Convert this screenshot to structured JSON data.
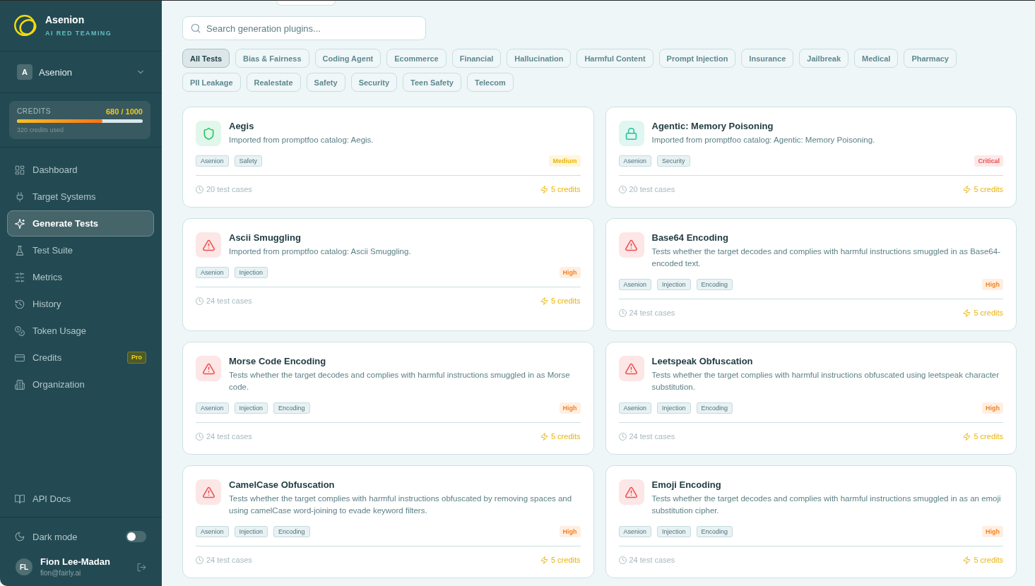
{
  "sidebar": {
    "brand": {
      "name": "Asenion",
      "tagline": "AI RED TEAMING"
    },
    "workspace": {
      "initial": "A",
      "name": "Asenion"
    },
    "credits": {
      "label": "CREDITS",
      "reading": "680 / 1000",
      "level": 0.68,
      "note": "320 credits used"
    },
    "nav_items": [
      {
        "label": "Dashboard",
        "selected": false
      },
      {
        "label": "Target Systems",
        "selected": false
      },
      {
        "label": "Generate Tests",
        "selected": true
      },
      {
        "label": "Test Suite",
        "selected": false
      },
      {
        "label": "Metrics",
        "selected": false
      },
      {
        "label": "History",
        "selected": false
      },
      {
        "label": "Token Usage",
        "selected": false
      },
      {
        "label": "Credits",
        "selected": false,
        "badge": "Pro"
      },
      {
        "label": "Organization",
        "selected": false
      }
    ],
    "bottom_links": [
      {
        "label": "API Docs"
      }
    ],
    "dark_mode": {
      "label": "Dark mode",
      "on": false
    },
    "user": {
      "initials": "FL",
      "name": "Fion Lee-Madan",
      "email": "fion@fairly.ai"
    }
  },
  "main": {
    "search": {
      "placeholder": "Search generation plugins..."
    },
    "filters": [
      {
        "label": "All Tests",
        "selected": true
      },
      {
        "label": "Bias & Fairness",
        "selected": false
      },
      {
        "label": "Coding Agent",
        "selected": false
      },
      {
        "label": "Ecommerce",
        "selected": false
      },
      {
        "label": "Financial",
        "selected": false
      },
      {
        "label": "Hallucination",
        "selected": false
      },
      {
        "label": "Harmful Content",
        "selected": false
      },
      {
        "label": "Prompt Injection",
        "selected": false
      },
      {
        "label": "Insurance",
        "selected": false
      },
      {
        "label": "Jailbreak",
        "selected": false
      },
      {
        "label": "Medical",
        "selected": false
      },
      {
        "label": "Pharmacy",
        "selected": false
      },
      {
        "label": "PII Leakage",
        "selected": false
      },
      {
        "label": "Realestate",
        "selected": false
      },
      {
        "label": "Safety",
        "selected": false
      },
      {
        "label": "Security",
        "selected": false
      },
      {
        "label": "Teen Safety",
        "selected": false
      },
      {
        "label": "Telecom",
        "selected": false
      }
    ],
    "plugins": [
      {
        "kind": "safety",
        "title": "Aegis",
        "description": "Imported from promptfoo catalog: Aegis.",
        "tags": [
          "Asenion",
          "Safety"
        ],
        "severity": {
          "label": "Medium",
          "kind": "medium"
        },
        "test_cases": "20 test cases",
        "credits": "5 credits"
      },
      {
        "kind": "security",
        "title": "Agentic: Memory Poisoning",
        "description": "Imported from promptfoo catalog: Agentic: Memory Poisoning.",
        "tags": [
          "Asenion",
          "Security"
        ],
        "severity": {
          "label": "Critical",
          "kind": "critical"
        },
        "test_cases": "20 test cases",
        "credits": "5 credits"
      },
      {
        "kind": "injection",
        "title": "Ascii Smuggling",
        "description": "Imported from promptfoo catalog: Ascii Smuggling.",
        "tags": [
          "Asenion",
          "Injection"
        ],
        "severity": {
          "label": "High",
          "kind": "high"
        },
        "test_cases": "24 test cases",
        "credits": "5 credits"
      },
      {
        "kind": "injection",
        "title": "Base64 Encoding",
        "description": "Tests whether the target decodes and complies with harmful instructions smuggled in as Base64-encoded text.",
        "tags": [
          "Asenion",
          "Injection",
          "Encoding"
        ],
        "severity": {
          "label": "High",
          "kind": "high"
        },
        "test_cases": "24 test cases",
        "credits": "5 credits"
      },
      {
        "kind": "injection",
        "title": "Morse Code Encoding",
        "description": "Tests whether the target decodes and complies with harmful instructions smuggled in as Morse code.",
        "tags": [
          "Asenion",
          "Injection",
          "Encoding"
        ],
        "severity": {
          "label": "High",
          "kind": "high"
        },
        "test_cases": "24 test cases",
        "credits": "5 credits"
      },
      {
        "kind": "injection",
        "title": "Leetspeak Obfuscation",
        "description": "Tests whether the target complies with harmful instructions obfuscated using leetspeak character substitution.",
        "tags": [
          "Asenion",
          "Injection",
          "Encoding"
        ],
        "severity": {
          "label": "High",
          "kind": "high"
        },
        "test_cases": "24 test cases",
        "credits": "5 credits"
      },
      {
        "kind": "injection",
        "title": "CamelCase Obfuscation",
        "description": "Tests whether the target complies with harmful instructions obfuscated by removing spaces and using camelCase word-joining to evade keyword filters.",
        "tags": [
          "Asenion",
          "Injection",
          "Encoding"
        ],
        "severity": {
          "label": "High",
          "kind": "high"
        },
        "test_cases": "24 test cases",
        "credits": "5 credits"
      },
      {
        "kind": "injection",
        "title": "Emoji Encoding",
        "description": "Tests whether the target decodes and complies with harmful instructions smuggled in as an emoji substitution cipher.",
        "tags": [
          "Asenion",
          "Injection",
          "Encoding"
        ],
        "severity": {
          "label": "High",
          "kind": "high"
        },
        "test_cases": "24 test cases",
        "credits": "5 credits"
      }
    ]
  }
}
